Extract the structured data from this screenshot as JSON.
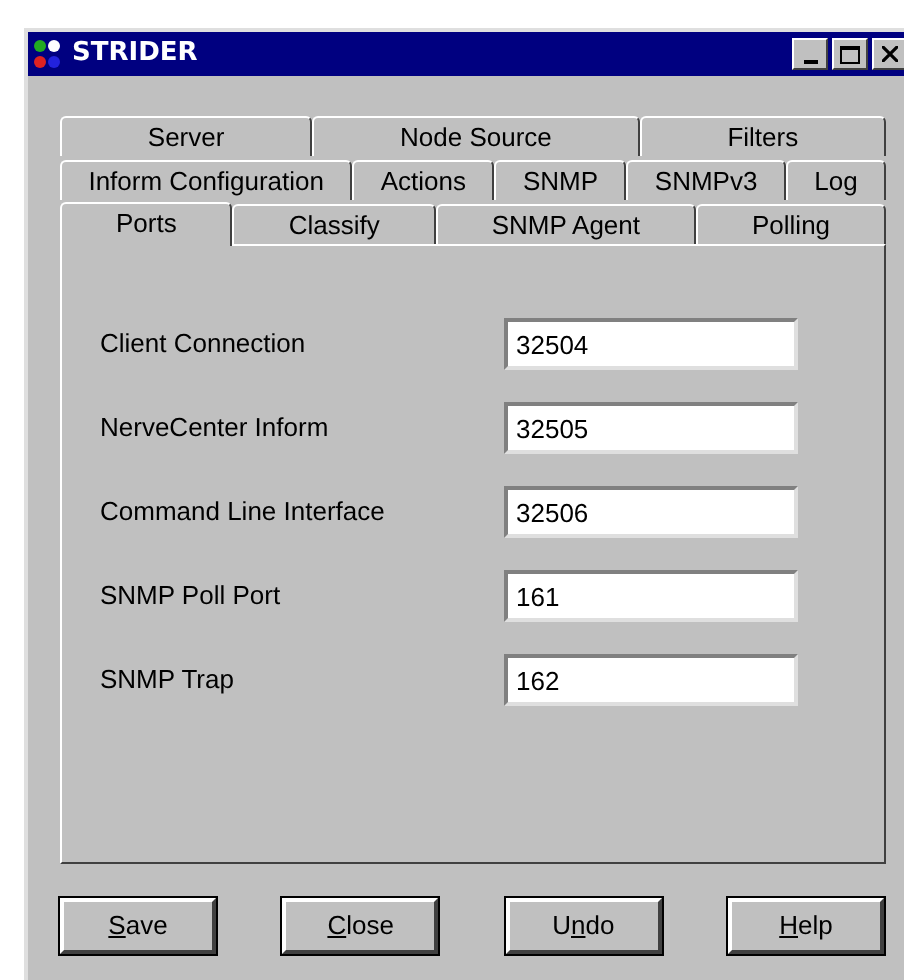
{
  "window": {
    "title": "STRIDER"
  },
  "tab_rows": [
    [
      {
        "label": "Server",
        "selected": false
      },
      {
        "label": "Node Source",
        "selected": false
      },
      {
        "label": "Filters",
        "selected": false
      }
    ],
    [
      {
        "label": "Inform Configuration",
        "selected": false
      },
      {
        "label": "Actions",
        "selected": false
      },
      {
        "label": "SNMP",
        "selected": false
      },
      {
        "label": "SNMPv3",
        "selected": false
      },
      {
        "label": "Log",
        "selected": false
      }
    ],
    [
      {
        "label": "Ports",
        "selected": true
      },
      {
        "label": "Classify",
        "selected": false
      },
      {
        "label": "SNMP Agent",
        "selected": false
      },
      {
        "label": "Polling",
        "selected": false
      }
    ]
  ],
  "fields": [
    {
      "label": "Client Connection",
      "value": "32504"
    },
    {
      "label": "NerveCenter Inform",
      "value": "32505"
    },
    {
      "label": "Command Line Interface",
      "value": "32506"
    },
    {
      "label": "SNMP Poll Port",
      "value": "161"
    },
    {
      "label": "SNMP Trap",
      "value": "162"
    }
  ],
  "buttons": [
    {
      "key": "S",
      "after": "ave"
    },
    {
      "key": "C",
      "after": "lose"
    },
    {
      "before": "U",
      "key": "n",
      "after": "do"
    },
    {
      "key": "H",
      "after": "elp"
    }
  ]
}
